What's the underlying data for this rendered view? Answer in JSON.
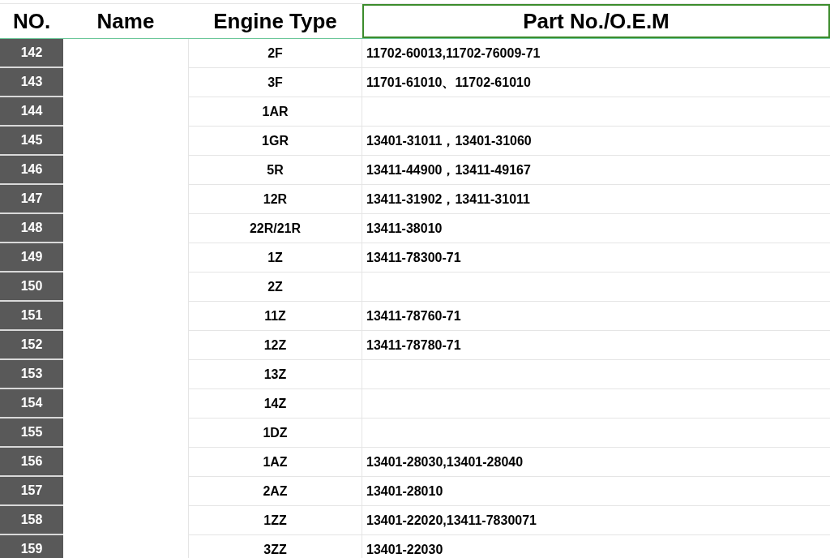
{
  "columns": [
    {
      "label": "NO.",
      "selected": false
    },
    {
      "label": "Name",
      "selected": false
    },
    {
      "label": "Engine Type",
      "selected": false
    },
    {
      "label": "Part No./O.E.M",
      "selected": true
    }
  ],
  "rows": [
    {
      "no": "142",
      "engine": "2F",
      "part": "11702-60013,11702-76009-71"
    },
    {
      "no": "143",
      "engine": "3F",
      "part": "11701-61010、11702-61010"
    },
    {
      "no": "144",
      "engine": "1AR"
    },
    {
      "no": "145",
      "engine": "1GR",
      "part": "13401-31011，13401-31060"
    },
    {
      "no": "146",
      "engine": "5R",
      "part": "13411-44900，13411-49167"
    },
    {
      "no": "147",
      "engine": "12R",
      "part": "13411-31902，13411-31011"
    },
    {
      "no": "148",
      "engine": "22R/21R",
      "part": "13411-38010"
    },
    {
      "no": "149",
      "engine": "1Z",
      "part": "13411-78300-71"
    },
    {
      "no": "150",
      "engine": "2Z"
    },
    {
      "no": "151",
      "engine": "11Z",
      "part": "13411-78760-71"
    },
    {
      "no": "152",
      "engine": "12Z",
      "part": "13411-78780-71"
    },
    {
      "no": "153",
      "engine": "13Z"
    },
    {
      "no": "154",
      "engine": "14Z"
    },
    {
      "no": "155",
      "engine": "1DZ"
    },
    {
      "no": "156",
      "engine": "1AZ",
      "part": "13401-28030,13401-28040"
    },
    {
      "no": "157",
      "engine": "2AZ",
      "part": "13401-28010"
    },
    {
      "no": "158",
      "engine": "1ZZ",
      "part": "13401-22020,13411-7830071"
    },
    {
      "no": "159",
      "engine": "3ZZ",
      "part": "13401-22030"
    }
  ]
}
